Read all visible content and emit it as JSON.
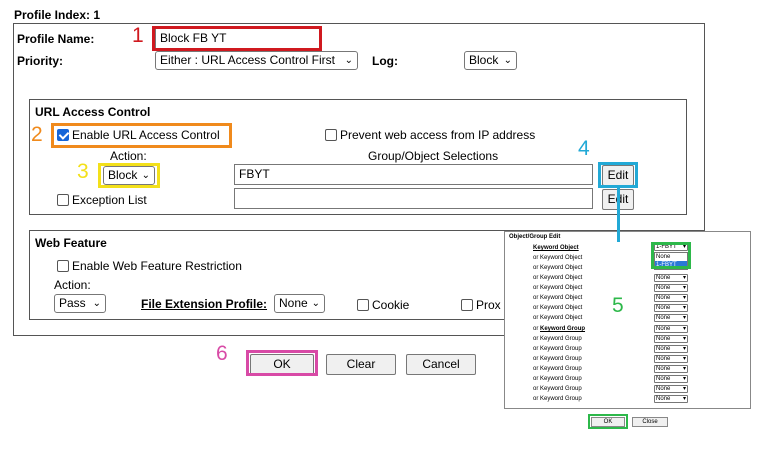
{
  "profile_index": "Profile Index: 1",
  "profile_name": {
    "label": "Profile Name:",
    "value": "Block FB YT"
  },
  "priority": {
    "label": "Priority:",
    "value": "Either : URL Access Control First"
  },
  "log": {
    "label": "Log:",
    "value": "Block"
  },
  "url_access": {
    "title": "URL Access Control",
    "enable_label": "Enable URL Access Control",
    "enable_checked": true,
    "prevent_ip_label": "Prevent web access from IP address",
    "prevent_ip_checked": false,
    "action_label": "Action:",
    "group_label": "Group/Object Selections",
    "action_value": "Block",
    "group_value": "FBYT",
    "edit_label": "Edit",
    "exception_label": "Exception List",
    "exception_value": "",
    "edit2_label": "Edit"
  },
  "web_feature": {
    "title": "Web Feature",
    "enable_label": "Enable Web Feature Restriction",
    "action_label": "Action:",
    "action_value": "Pass",
    "file_ext_label": "File Extension Profile:",
    "file_ext_value": "None",
    "cookie_label": "Cookie",
    "proxy_label": "Prox"
  },
  "buttons": {
    "ok": "OK",
    "clear": "Clear",
    "cancel": "Cancel"
  },
  "popup": {
    "title": "Object/Group Edit",
    "keyword_object_label": "Keyword Object",
    "or_keyword_object": "or Keyword Object",
    "keyword_group_label": "Keyword Group",
    "or_keyword_group": "or Keyword Group",
    "first_select": "1-FBYT",
    "dropdown_options": [
      "None",
      "1-FBYT"
    ],
    "none_value": "None",
    "ok": "OK",
    "close": "Close"
  },
  "annotations": {
    "n1": "1",
    "n2": "2",
    "n3": "3",
    "n4": "4",
    "n5": "5",
    "n6": "6"
  },
  "colors": {
    "red": "#d0191f",
    "orange": "#f08a1c",
    "yellow": "#f3e01a",
    "cyan": "#22a9d6",
    "green": "#2db84a",
    "magenta": "#d84aa6",
    "checkbox_blue": "#1565d8"
  }
}
